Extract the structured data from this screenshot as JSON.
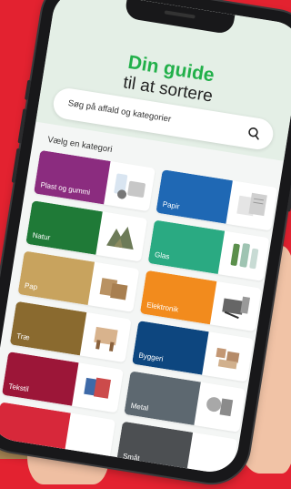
{
  "header": {
    "title_line1": "Din guide",
    "title_line2": "til at sortere"
  },
  "search": {
    "placeholder": "Søg på affald og kategorier",
    "icon": "search-icon"
  },
  "section": {
    "title": "Vælg en kategori"
  },
  "categories": [
    {
      "label": "Plast og gummi",
      "color": "#8b2c7f"
    },
    {
      "label": "Papir",
      "color": "#1f68b4"
    },
    {
      "label": "Natur",
      "color": "#1f7a37"
    },
    {
      "label": "Glas",
      "color": "#2aaa82"
    },
    {
      "label": "Pap",
      "color": "#c8a35e"
    },
    {
      "label": "Elektronik",
      "color": "#f28b1d"
    },
    {
      "label": "Træ",
      "color": "#8a6a2f"
    },
    {
      "label": "Byggeri",
      "color": "#0d467f"
    },
    {
      "label": "Tekstil",
      "color": "#9c1638"
    },
    {
      "label": "Metal",
      "color": "#5d6870"
    },
    {
      "label": "",
      "color": "#d7283a"
    },
    {
      "label": "Småt",
      "color": "#4c4f52"
    }
  ]
}
